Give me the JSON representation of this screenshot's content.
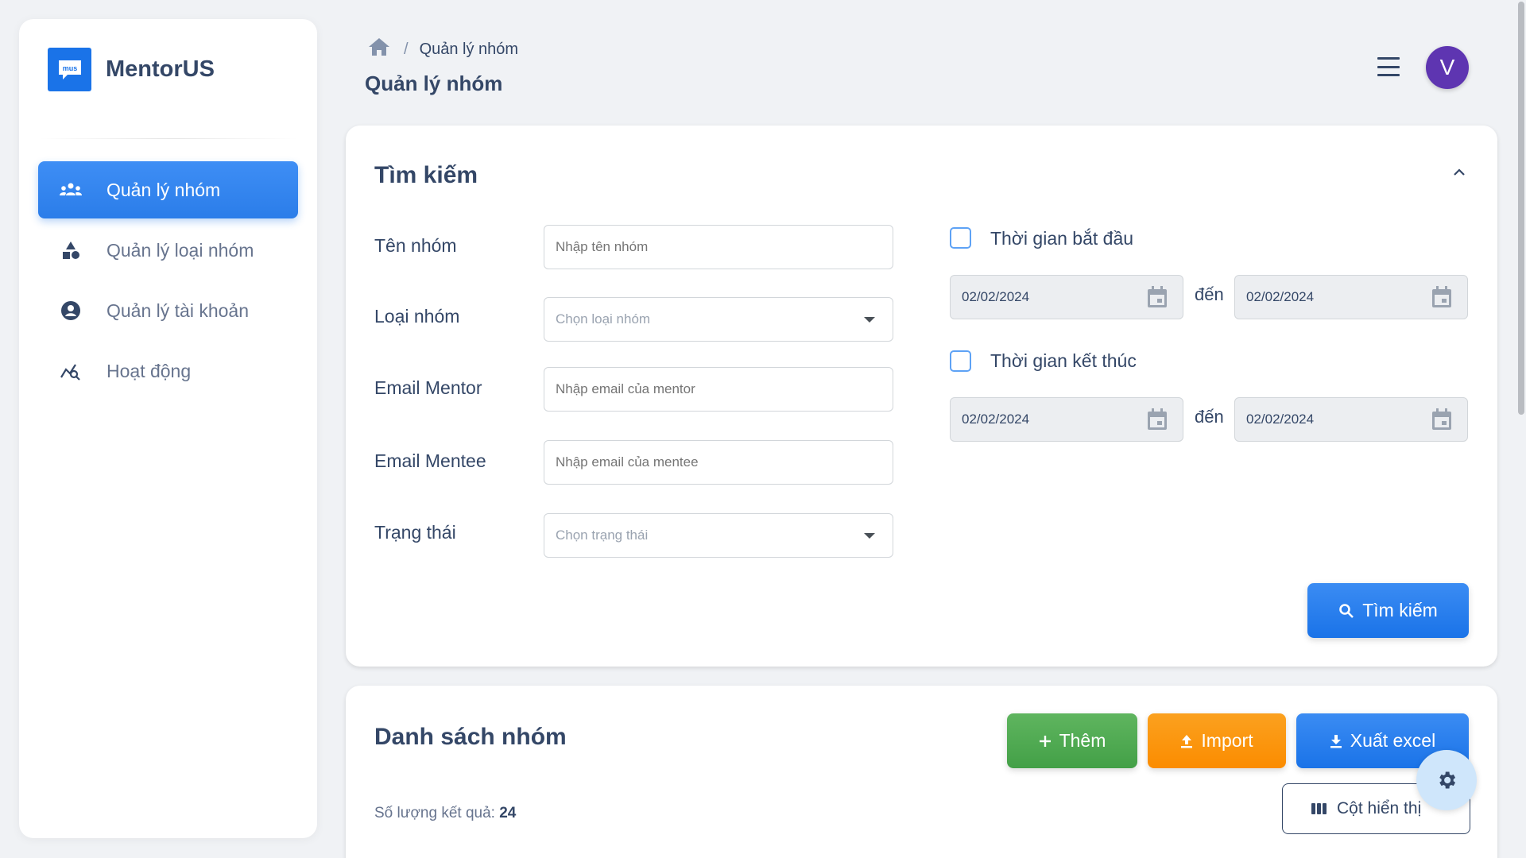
{
  "brand": {
    "logo_text": "mus",
    "name": "MentorUS"
  },
  "sidebar": {
    "items": [
      {
        "label": "Quản lý nhóm",
        "icon": "groups-icon",
        "active": true
      },
      {
        "label": "Quản lý loại nhóm",
        "icon": "category-icon",
        "active": false
      },
      {
        "label": "Quản lý tài khoản",
        "icon": "account-circle-icon",
        "active": false
      },
      {
        "label": "Hoạt động",
        "icon": "activity-chart-icon",
        "active": false
      }
    ]
  },
  "header": {
    "breadcrumb": {
      "separator": "/",
      "current": "Quản lý nhóm"
    },
    "title": "Quản lý nhóm",
    "avatar_initial": "V"
  },
  "search": {
    "title": "Tìm kiếm",
    "fields": {
      "group_name": {
        "label": "Tên nhóm",
        "placeholder": "Nhập tên nhóm",
        "value": ""
      },
      "group_type": {
        "label": "Loại nhóm",
        "placeholder": "Chọn loại nhóm",
        "value": ""
      },
      "mentor_email": {
        "label": "Email Mentor",
        "placeholder": "Nhập email của mentor",
        "value": ""
      },
      "mentee_email": {
        "label": "Email Mentee",
        "placeholder": "Nhập email của mentee",
        "value": ""
      },
      "status": {
        "label": "Trạng thái",
        "placeholder": "Chọn trạng thái",
        "value": ""
      }
    },
    "start_time": {
      "label": "Thời gian bắt đầu",
      "checked": false,
      "from": "02/02/2024",
      "to_label": "đến",
      "to": "02/02/2024"
    },
    "end_time": {
      "label": "Thời gian kết thúc",
      "checked": false,
      "from": "02/02/2024",
      "to_label": "đến",
      "to": "02/02/2024"
    },
    "submit_label": "Tìm kiếm"
  },
  "list": {
    "title": "Danh sách nhóm",
    "add_label": "Thêm",
    "import_label": "Import",
    "export_label": "Xuất excel",
    "result_label": "Số lượng kết quả:",
    "result_count": "24",
    "columns_label": "Cột hiển thị"
  },
  "colors": {
    "primary": "#1a73e8",
    "success": "#43a047",
    "warning": "#fb8c00",
    "avatar": "#5e35b1",
    "text": "#344767"
  }
}
